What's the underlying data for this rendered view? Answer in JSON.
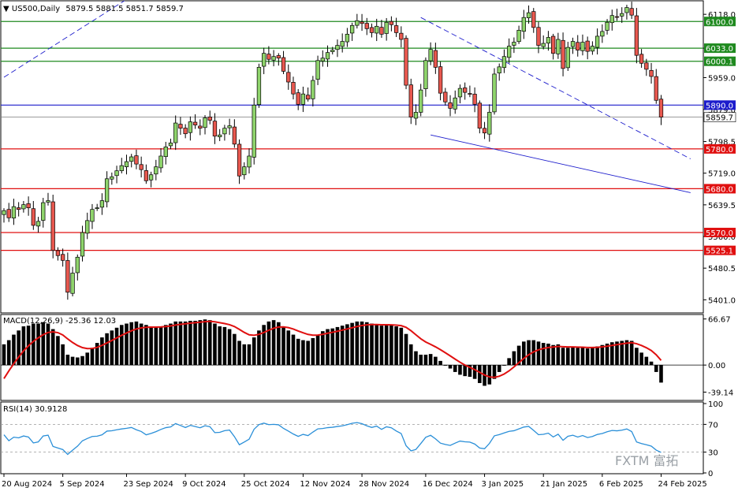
{
  "chart_data": {
    "type": "candlestick",
    "symbol": "US500",
    "timeframe": "Daily",
    "header_ohlc": "5879.5 5881.5 5851.7 5859.7",
    "current_price": "5859.7",
    "price_axis": {
      "range": [
        5370,
        6150
      ],
      "ticks": [
        "6118.0",
        "6033.0",
        "5959.0",
        "5879.0",
        "5798.5",
        "5719.0",
        "5639.5",
        "5560.0",
        "5480.5",
        "5401.0"
      ]
    },
    "x_labels": [
      {
        "index": 0,
        "label": "20 Aug 2024"
      },
      {
        "index": 12,
        "label": "5 Sep 2024"
      },
      {
        "index": 25,
        "label": "23 Sep 2024"
      },
      {
        "index": 37,
        "label": "9 Oct 2024"
      },
      {
        "index": 49,
        "label": "25 Oct 2024"
      },
      {
        "index": 61,
        "label": "12 Nov 2024"
      },
      {
        "index": 73,
        "label": "28 Nov 2024"
      },
      {
        "index": 86,
        "label": "16 Dec 2024"
      },
      {
        "index": 98,
        "label": "3 Jan 2025"
      },
      {
        "index": 110,
        "label": "21 Jan 2025"
      },
      {
        "index": 122,
        "label": "6 Feb 2025"
      },
      {
        "index": 134,
        "label": "24 Feb 2025"
      }
    ],
    "levels": [
      {
        "value": 6100.0,
        "label": "6100.0",
        "color": "#1f8a1f"
      },
      {
        "value": 6033.0,
        "label": "6033.0",
        "color": "#1f8a1f"
      },
      {
        "value": 6000.1,
        "label": "6000.1",
        "color": "#1f8a1f"
      },
      {
        "value": 5890.0,
        "label": "5890.0",
        "color": "#1c1ccc"
      },
      {
        "value": 5780.0,
        "label": "5780.0",
        "color": "#e01010"
      },
      {
        "value": 5680.0,
        "label": "5680.0",
        "color": "#e01010"
      },
      {
        "value": 5570.0,
        "label": "5570.0",
        "color": "#e01010"
      },
      {
        "value": 5525.1,
        "label": "5525.1",
        "color": "#e01010"
      }
    ],
    "trendlines": [
      {
        "from": [
          0,
          5960
        ],
        "to": [
          55,
          6390
        ],
        "style": "dashed",
        "color": "#1c1ccc"
      },
      {
        "from": [
          85,
          6110
        ],
        "to": [
          140,
          5755
        ],
        "style": "dashed",
        "color": "#1c1ccc"
      },
      {
        "from": [
          87,
          5815
        ],
        "to": [
          140,
          5670
        ],
        "style": "solid",
        "color": "#1c1ccc"
      }
    ],
    "closes": [
      5625,
      5607,
      5635,
      5628,
      5640,
      5632,
      5588,
      5598,
      5645,
      5650,
      5525,
      5512,
      5500,
      5420,
      5468,
      5508,
      5570,
      5600,
      5628,
      5632,
      5650,
      5705,
      5710,
      5725,
      5738,
      5748,
      5760,
      5742,
      5728,
      5700,
      5715,
      5735,
      5762,
      5785,
      5795,
      5845,
      5832,
      5818,
      5848,
      5840,
      5832,
      5858,
      5852,
      5812,
      5815,
      5832,
      5838,
      5792,
      5712,
      5735,
      5762,
      5890,
      5985,
      6020,
      6005,
      6012,
      6008,
      5975,
      5948,
      5918,
      5892,
      5918,
      5905,
      5952,
      6002,
      6008,
      6022,
      6028,
      6040,
      6050,
      6068,
      6090,
      6102,
      6095,
      6082,
      6072,
      6088,
      6068,
      6098,
      6092,
      6072,
      6055,
      5940,
      5860,
      5872,
      5928,
      6002,
      6030,
      5985,
      5920,
      5898,
      5882,
      5908,
      5932,
      5922,
      5918,
      5892,
      5832,
      5820,
      5872,
      5968,
      5986,
      6012,
      6038,
      6048,
      6078,
      6110,
      6122,
      6085,
      6040,
      6045,
      6060,
      6020,
      6055,
      5982,
      6035,
      6050,
      6028,
      6048,
      6025,
      6038,
      6063,
      6075,
      6098,
      6115,
      6112,
      6120,
      6135,
      6116,
      6015,
      5995,
      5980,
      5962,
      5902,
      5859.7
    ],
    "macd": {
      "label": "MACD(12,26,9) -25.36 12.03",
      "ticks": [
        "66.67",
        "0.00",
        "-39.14"
      ],
      "range": [
        -50,
        72
      ],
      "histogram": [
        30,
        36,
        44,
        50,
        56,
        57,
        60,
        60,
        62,
        60,
        52,
        42,
        30,
        15,
        12,
        11,
        13,
        18,
        25,
        32,
        40,
        46,
        50,
        54,
        58,
        60,
        62,
        63,
        60,
        58,
        56,
        55,
        56,
        58,
        60,
        63,
        63,
        63,
        64,
        64,
        65,
        66,
        65,
        60,
        56,
        55,
        52,
        45,
        35,
        30,
        30,
        40,
        50,
        58,
        63,
        65,
        62,
        56,
        50,
        44,
        38,
        36,
        35,
        39,
        44,
        49,
        52,
        53,
        55,
        57,
        59,
        61,
        63,
        63,
        62,
        60,
        59,
        57,
        58,
        58,
        56,
        54,
        45,
        30,
        20,
        15,
        15,
        16,
        12,
        6,
        0,
        -5,
        -10,
        -14,
        -16,
        -17,
        -20,
        -26,
        -30,
        -28,
        -20,
        -10,
        0,
        10,
        20,
        28,
        34,
        36,
        36,
        34,
        32,
        31,
        29,
        30,
        25,
        25,
        26,
        25,
        25,
        24,
        25,
        27,
        29,
        31,
        33,
        34,
        35,
        36,
        35,
        25,
        18,
        12,
        5,
        -10,
        -25.36
      ],
      "signal_start": -32,
      "signal_line": "red"
    },
    "rsi": {
      "label": "RSI(14) 30.9128",
      "ticks": [
        "100",
        "70",
        "30",
        "0"
      ],
      "range": [
        0,
        100
      ],
      "levels": [
        70,
        30
      ],
      "last": 30.9128
    }
  },
  "watermark": "FXTM 富拓"
}
